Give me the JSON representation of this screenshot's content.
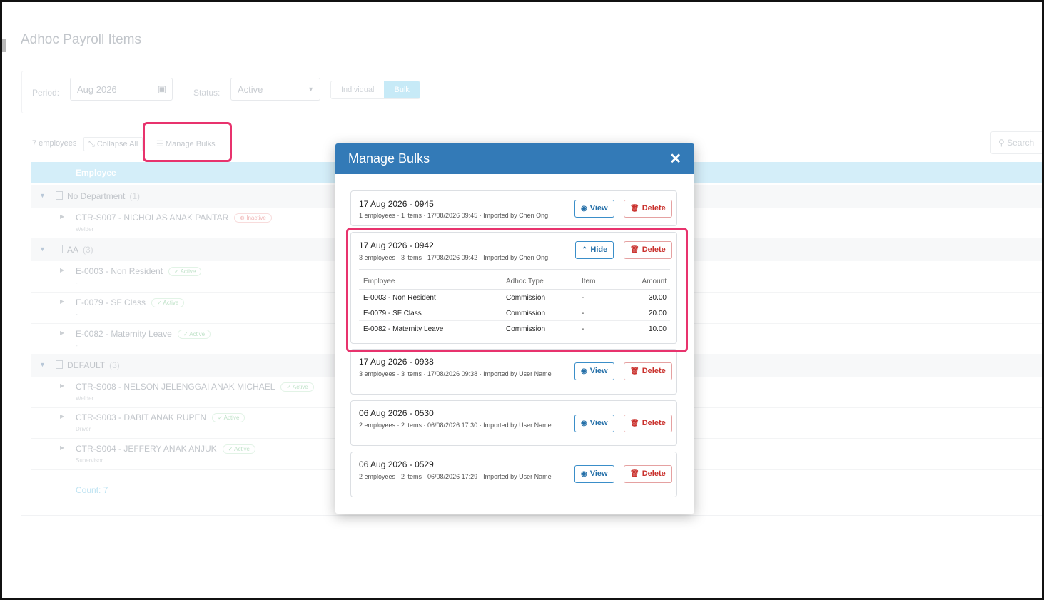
{
  "page": {
    "title": "Adhoc Payroll Items",
    "period_label": "Period:",
    "period_value": "Aug 2026",
    "status_label": "Status:",
    "status_value": "Active",
    "mode_individual": "Individual",
    "mode_bulk": "Bulk",
    "employee_count": "7 employees",
    "collapse_all": "Collapse All",
    "manage_bulks": "Manage Bulks",
    "search_placeholder": "Search",
    "column_employee": "Employee",
    "groups": [
      {
        "name": "No Department",
        "count": "(1)"
      },
      {
        "name": "AA",
        "count": "(3)"
      },
      {
        "name": "DEFAULT",
        "count": "(3)"
      }
    ],
    "rows": [
      {
        "name": "CTR-S007 - NICHOLAS ANAK PANTAR",
        "status": "Inactive",
        "sub": "Welder"
      },
      {
        "name": "E-0003 - Non Resident",
        "status": "Active",
        "sub": "-"
      },
      {
        "name": "E-0079 - SF Class",
        "status": "Active",
        "sub": "-"
      },
      {
        "name": "E-0082 - Maternity Leave",
        "status": "Active",
        "sub": "-"
      },
      {
        "name": "CTR-S008 - NELSON JELENGGAI ANAK MICHAEL",
        "status": "Active",
        "sub": "Welder"
      },
      {
        "name": "CTR-S003 - DABIT ANAK RUPEN",
        "status": "Active",
        "sub": "Driver"
      },
      {
        "name": "CTR-S004 - JEFFERY ANAK ANJUK",
        "status": "Active",
        "sub": "Supervisor"
      }
    ],
    "count_footer": "Count: 7"
  },
  "modal": {
    "title": "Manage Bulks",
    "close_glyph": "✕",
    "view_label": "View",
    "hide_label": "Hide",
    "delete_label": "Delete",
    "bulks": [
      {
        "title": "17 Aug 2026 - 0945",
        "meta": "1 employees · 1 items · 17/08/2026 09:45 · Imported by Chen Ong"
      },
      {
        "title": "17 Aug 2026 - 0942",
        "meta": "3 employees · 3 items · 17/08/2026 09:42 · Imported by Chen Ong"
      },
      {
        "title": "17 Aug 2026 - 0938",
        "meta": "3 employees · 3 items · 17/08/2026 09:38 · Imported by User Name"
      },
      {
        "title": "06 Aug 2026 - 0530",
        "meta": "2 employees · 2 items · 06/08/2026 17:30 · Imported by User Name"
      },
      {
        "title": "06 Aug 2026 - 0529",
        "meta": "2 employees · 2 items · 06/08/2026 17:29 · Imported by User Name"
      }
    ],
    "detail": {
      "headers": [
        "Employee",
        "Adhoc Type",
        "Item",
        "Amount"
      ],
      "rows": [
        [
          "E-0003 - Non Resident",
          "Commission",
          "-",
          "30.00"
        ],
        [
          "E-0079 - SF Class",
          "Commission",
          "-",
          "20.00"
        ],
        [
          "E-0082 - Maternity Leave",
          "Commission",
          "-",
          "10.00"
        ]
      ]
    }
  },
  "colors": {
    "modal_header": "#337ab7",
    "highlight": "#e8336d",
    "delete": "#c9302c"
  }
}
